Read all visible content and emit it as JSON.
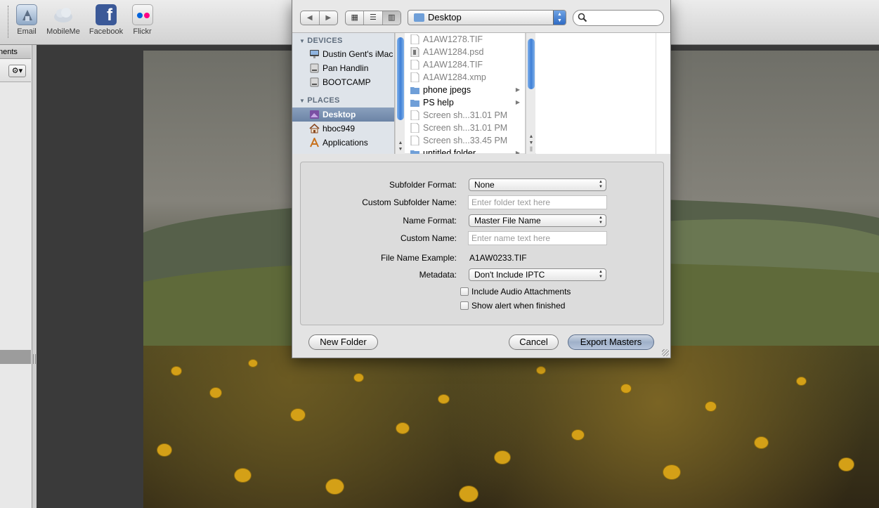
{
  "toolbar": {
    "items": [
      {
        "label": "Email",
        "icon": "email-icon"
      },
      {
        "label": "MobileMe",
        "icon": "mobileme-cloud-icon"
      },
      {
        "label": "Facebook",
        "icon": "facebook-icon"
      },
      {
        "label": "Flickr",
        "icon": "flickr-icon"
      }
    ]
  },
  "left_panel": {
    "tab_label": "nents"
  },
  "dialog": {
    "location": "Desktop",
    "search_placeholder": "",
    "sidebar": {
      "devices_header": "DEVICES",
      "places_header": "PLACES",
      "devices": [
        "Dustin Gent's iMac",
        "Pan Handlin",
        "BOOTCAMP"
      ],
      "places": [
        "Desktop",
        "hboc949",
        "Applications"
      ],
      "selected": "Desktop"
    },
    "files": [
      {
        "name": "A1AW1278.TIF",
        "kind": "file"
      },
      {
        "name": "A1AW1284.psd",
        "kind": "file"
      },
      {
        "name": "A1AW1284.TIF",
        "kind": "file"
      },
      {
        "name": "A1AW1284.xmp",
        "kind": "file"
      },
      {
        "name": "phone jpegs",
        "kind": "folder"
      },
      {
        "name": "PS help",
        "kind": "folder"
      },
      {
        "name": "Screen sh...31.01 PM",
        "kind": "file"
      },
      {
        "name": "Screen sh...31.01 PM",
        "kind": "file"
      },
      {
        "name": "Screen sh...33.45 PM",
        "kind": "file"
      },
      {
        "name": "untitled folder",
        "kind": "folder"
      }
    ],
    "options": {
      "subfolder_format_label": "Subfolder Format:",
      "subfolder_format_value": "None",
      "custom_subfolder_label": "Custom Subfolder Name:",
      "custom_subfolder_placeholder": "Enter folder text here",
      "name_format_label": "Name Format:",
      "name_format_value": "Master File Name",
      "custom_name_label": "Custom Name:",
      "custom_name_placeholder": "Enter name text here",
      "example_label": "File Name Example:",
      "example_value": "A1AW0233.TIF",
      "metadata_label": "Metadata:",
      "metadata_value": "Don't Include IPTC",
      "audio_label": "Include Audio Attachments",
      "alert_label": "Show alert when finished"
    },
    "buttons": {
      "new_folder": "New Folder",
      "cancel": "Cancel",
      "export": "Export Masters"
    }
  },
  "colors": {
    "selection": "#6c84a6",
    "default_button": "#9fb0c9",
    "scroll_thumb": "#3f7fd6"
  }
}
